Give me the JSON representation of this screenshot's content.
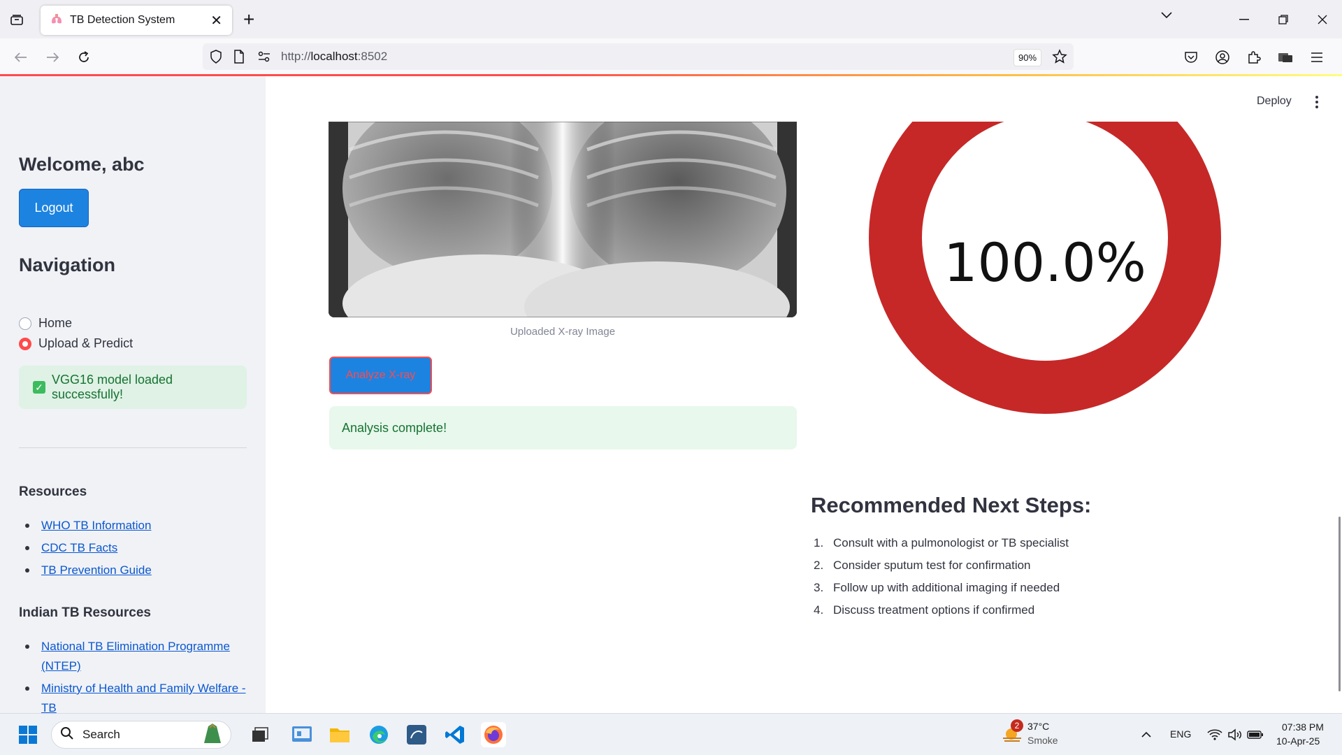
{
  "browser": {
    "tab_title": "TB Detection System",
    "url_prefix": "http://",
    "url_host": "localhost",
    "url_port": ":8502",
    "zoom": "90%"
  },
  "sidebar": {
    "welcome": "Welcome, abc",
    "logout_label": "Logout",
    "nav_heading": "Navigation",
    "nav_options": [
      {
        "label": "Home",
        "selected": false
      },
      {
        "label": "Upload & Predict",
        "selected": true
      }
    ],
    "model_status": "VGG16 model loaded successfully!",
    "resources_heading": "Resources",
    "resources": [
      "WHO TB Information",
      "CDC TB Facts",
      "TB Prevention Guide"
    ],
    "indian_heading": "Indian TB Resources",
    "indian_resources": [
      "National TB Elimination Programme (NTEP)",
      "Ministry of Health and Family Welfare - TB"
    ]
  },
  "header": {
    "deploy_label": "Deploy"
  },
  "main": {
    "xray_caption": "Uploaded X-ray Image",
    "analyze_label": "Analyze X-ray",
    "analysis_status": "Analysis complete!",
    "gauge": {
      "value_label": "100.0%",
      "fraction": 1.0,
      "color": "#c62828"
    },
    "steps_heading": "Recommended Next Steps:",
    "steps": [
      {
        "num": "1.",
        "text": "Consult with a pulmonologist or TB specialist"
      },
      {
        "num": "2.",
        "text": "Consider sputum test for confirmation"
      },
      {
        "num": "3.",
        "text": "Follow up with additional imaging if needed"
      },
      {
        "num": "4.",
        "text": "Discuss treatment options if confirmed"
      }
    ]
  },
  "taskbar": {
    "search_placeholder": "Search",
    "weather_badge": "2",
    "temperature": "37°C",
    "weather": "Smoke",
    "language": "ENG",
    "time": "07:38 PM",
    "date": "10-Apr-25"
  },
  "colors": {
    "primary": "#1c83e1",
    "accent": "#ff4b4b",
    "success_bg": "#dff2e5",
    "success_text": "#177233"
  }
}
